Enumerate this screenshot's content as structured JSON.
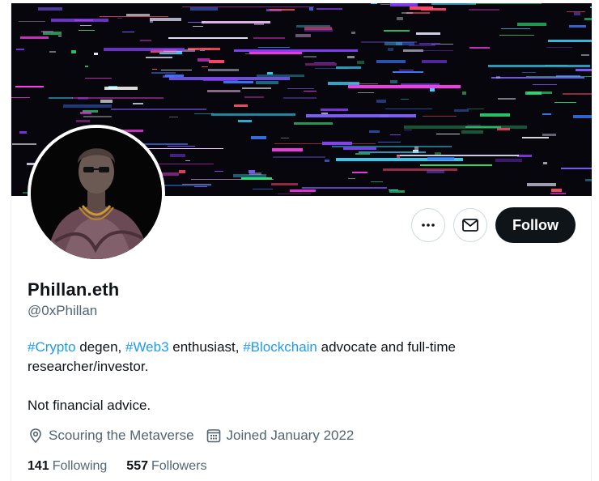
{
  "profile": {
    "display_name": "Phillan.eth",
    "handle": "@0xPhillan",
    "bio": {
      "line1": [
        {
          "text": "#Crypto",
          "hashtag": true
        },
        {
          "text": " degen, ",
          "hashtag": false
        },
        {
          "text": "#Web3",
          "hashtag": true
        },
        {
          "text": " enthusiast, ",
          "hashtag": false
        },
        {
          "text": "#Blockchain",
          "hashtag": true
        },
        {
          "text": " advocate and full-time researcher/investor.",
          "hashtag": false
        }
      ],
      "line2": "Not financial advice."
    },
    "location": "Scouring the Metaverse",
    "joined": "Joined January 2022",
    "following_count": "141",
    "following_label": "Following",
    "followers_count": "557",
    "followers_label": "Followers"
  },
  "actions": {
    "more_icon": "more-horizontal-icon",
    "message_icon": "envelope-icon",
    "follow_label": "Follow"
  },
  "colors": {
    "link": "#1d9bf0",
    "text": "#0f1419",
    "secondary": "#536471",
    "button_bg": "#0f1419",
    "border": "#cfd9de"
  }
}
